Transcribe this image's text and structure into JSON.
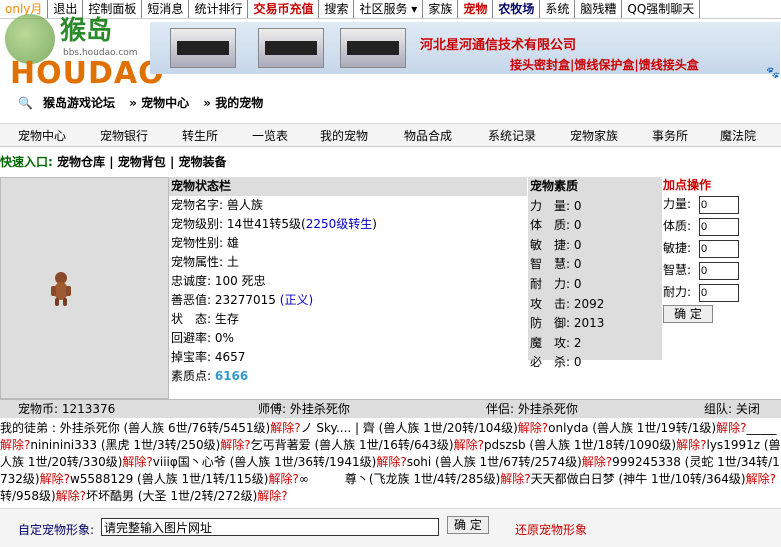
{
  "topnav": {
    "items": [
      {
        "label": "only月",
        "style": "warn"
      },
      {
        "label": "退出",
        "style": ""
      },
      {
        "label": "控制面板",
        "style": ""
      },
      {
        "label": "短消息",
        "style": ""
      },
      {
        "label": "统计排行",
        "style": ""
      },
      {
        "label": "交易币充值",
        "style": "red"
      },
      {
        "label": "搜索",
        "style": ""
      },
      {
        "label": "社区服务 ▾",
        "style": ""
      },
      {
        "label": "家族",
        "style": ""
      },
      {
        "label": "宠物",
        "style": "red"
      },
      {
        "label": "农牧场",
        "style": "blue"
      },
      {
        "label": "系统",
        "style": ""
      },
      {
        "label": "脑残糟",
        "style": ""
      },
      {
        "label": "QQ强制聊天",
        "style": ""
      }
    ]
  },
  "header": {
    "logo_cn": "猴岛",
    "logo_en": "HOUDAO",
    "logo_url": "bbs.houdao.com",
    "company": "河北星河通信技术有限公司",
    "slogan": "接头密封盒|馈线保护盒|馈线接头盒"
  },
  "breadcrumb": {
    "home": "猴岛游戏论坛",
    "section": "» 宠物中心",
    "current": "» 我的宠物"
  },
  "mainnav": {
    "items": [
      "宠物中心",
      "宠物银行",
      "转生所",
      "一览表",
      "我的宠物",
      "物品合成",
      "系统记录",
      "宠物家族",
      "事务所",
      "魔法院"
    ]
  },
  "quick": {
    "label": "快速入口:",
    "links": [
      "宠物仓库",
      "宠物背包",
      "宠物装备"
    ]
  },
  "status": {
    "title": "宠物状态栏",
    "name": "宠物名字: 兽人族",
    "level_prefix": "宠物级别: 14世41转5级(",
    "level_link": "2250级转生",
    "level_suffix": ")",
    "gender": "宠物性别: 雄",
    "attribute": "宠物属性: 土",
    "loyalty": "忠诚度: 100 死忠",
    "karma_prefix": "善恶值: 23277015 ",
    "karma_link": "(正义)",
    "state": "状　态: 生存",
    "dodge": "回避率: 0%",
    "drop": "掉宝率: 4657",
    "points_label": "素质点: ",
    "points_value": "6166"
  },
  "quality": {
    "title": "宠物素质",
    "rows": [
      "力　量: 0",
      "体　质: 0",
      "敏　捷: 0",
      "智　慧: 0",
      "耐　力: 0",
      "攻　击: 2092",
      "防　御: 2013",
      "魔　攻: 2",
      "必　杀: 0"
    ]
  },
  "bonus": {
    "title": "加点操作",
    "fields": [
      {
        "label": "力量:",
        "value": "0"
      },
      {
        "label": "体质:",
        "value": "0"
      },
      {
        "label": "敏捷:",
        "value": "0"
      },
      {
        "label": "智慧:",
        "value": "0"
      },
      {
        "label": "耐力:",
        "value": "0"
      }
    ],
    "confirm": "确 定"
  },
  "statline": {
    "coins": "宠物币: 1213376",
    "master": "师傅: 外挂杀死你",
    "partner": "伴侣: 外挂杀死你",
    "team": "组队: 关闭"
  },
  "disciples": {
    "intro": "我的徒弟 : ",
    "entries": [
      {
        "text": "外挂杀死你 (兽人族 6世/76转/5451级)",
        "rel": "解除?"
      },
      {
        "text": "ノ Sky.... | 齊 (兽人族 1世/20转/104级)",
        "rel": "解除?"
      },
      {
        "text": "onlyda (兽人族 1世/19转/1级)",
        "rel": "解除?"
      },
      {
        "text": "_____",
        "rel": "解除?"
      },
      {
        "text": "nininini333 (黑虎 1世/3转/250级)",
        "rel": "解除?"
      },
      {
        "text": "乞丐背著爱 (兽人族 1世/16转/643级)",
        "rel": "解除?"
      },
      {
        "text": "pdszsb (兽人族 1世/18转/1090级)",
        "rel": "解除?"
      },
      {
        "text": "lys1991z (兽人族 1世/20转/330级)",
        "rel": "解除?"
      },
      {
        "text": "viiiφ国丶心爷 (兽人族 1世/36转/1941级)",
        "rel": "解除?"
      },
      {
        "text": "sohi (兽人族 1世/67转/2574级)",
        "rel": "解除?"
      },
      {
        "text": "999245338 (灵蛇 1世/34转/1732级)",
        "rel": "解除?"
      },
      {
        "text": "w5588129 (兽人族 1世/1转/115级)",
        "rel": "解除?"
      },
      {
        "text": "∞　　　尊丶(飞龙族 1世/4转/285级)",
        "rel": "解除?"
      },
      {
        "text": "天天都做白日梦 (神牛 1世/10转/364级)",
        "rel": "解除?"
      },
      {
        "text": "转/958级)",
        "rel": "解除?"
      },
      {
        "text": "坏坏酷男 (大圣 1世/2转/272级)",
        "rel": "解除?"
      }
    ]
  },
  "footer": {
    "label": "自定宠物形象:",
    "input_value": "请完整输入图片网址",
    "confirm": "确 定",
    "restore": "还原宠物形象"
  }
}
